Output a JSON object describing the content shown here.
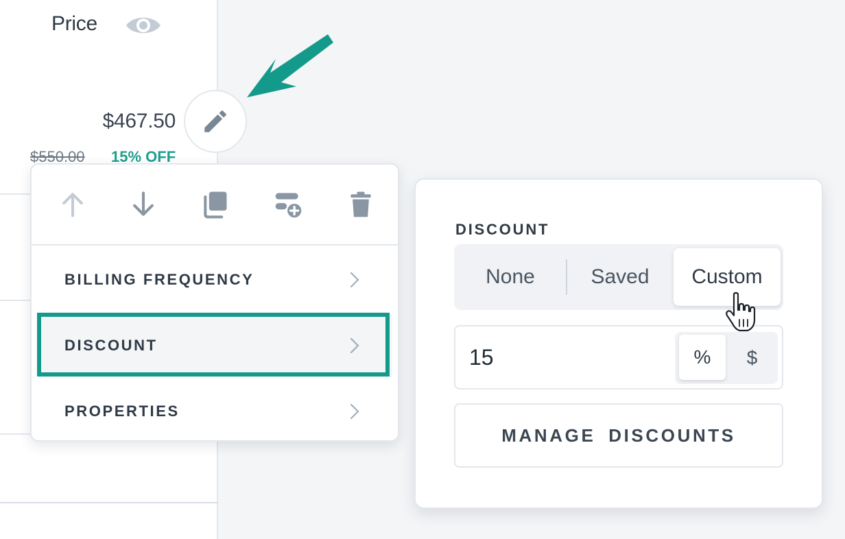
{
  "table": {
    "price_header": "Price",
    "price_value": "$467.50",
    "original_price": "$550.00",
    "discount_badge": "15% OFF"
  },
  "icons": {
    "visibility": "eye-icon",
    "edit": "pencil-icon",
    "annotation": "arrow-icon",
    "move_up": "arrow-up-icon",
    "move_down": "arrow-down-icon",
    "duplicate": "copy-icon",
    "add_option": "add-row-icon",
    "delete": "trash-icon",
    "chevron": "chevron-right-icon",
    "cursor": "hand-pointer-icon"
  },
  "menu": {
    "items": [
      {
        "label": "BILLING FREQUENCY"
      },
      {
        "label": "DISCOUNT"
      },
      {
        "label": "PROPERTIES"
      }
    ],
    "active_item": "DISCOUNT"
  },
  "discount_panel": {
    "title": "DISCOUNT",
    "options": [
      "None",
      "Saved",
      "Custom"
    ],
    "selected_option": "Custom",
    "amount_value": "15",
    "units": [
      "%",
      "$"
    ],
    "selected_unit": "%",
    "manage_button_label": "MANAGE  DISCOUNTS"
  },
  "colors": {
    "accent": "#139a8b",
    "discount_green": "#1f9e8f",
    "icon_gray": "#8a96a3",
    "background": "#f3f5f7"
  }
}
